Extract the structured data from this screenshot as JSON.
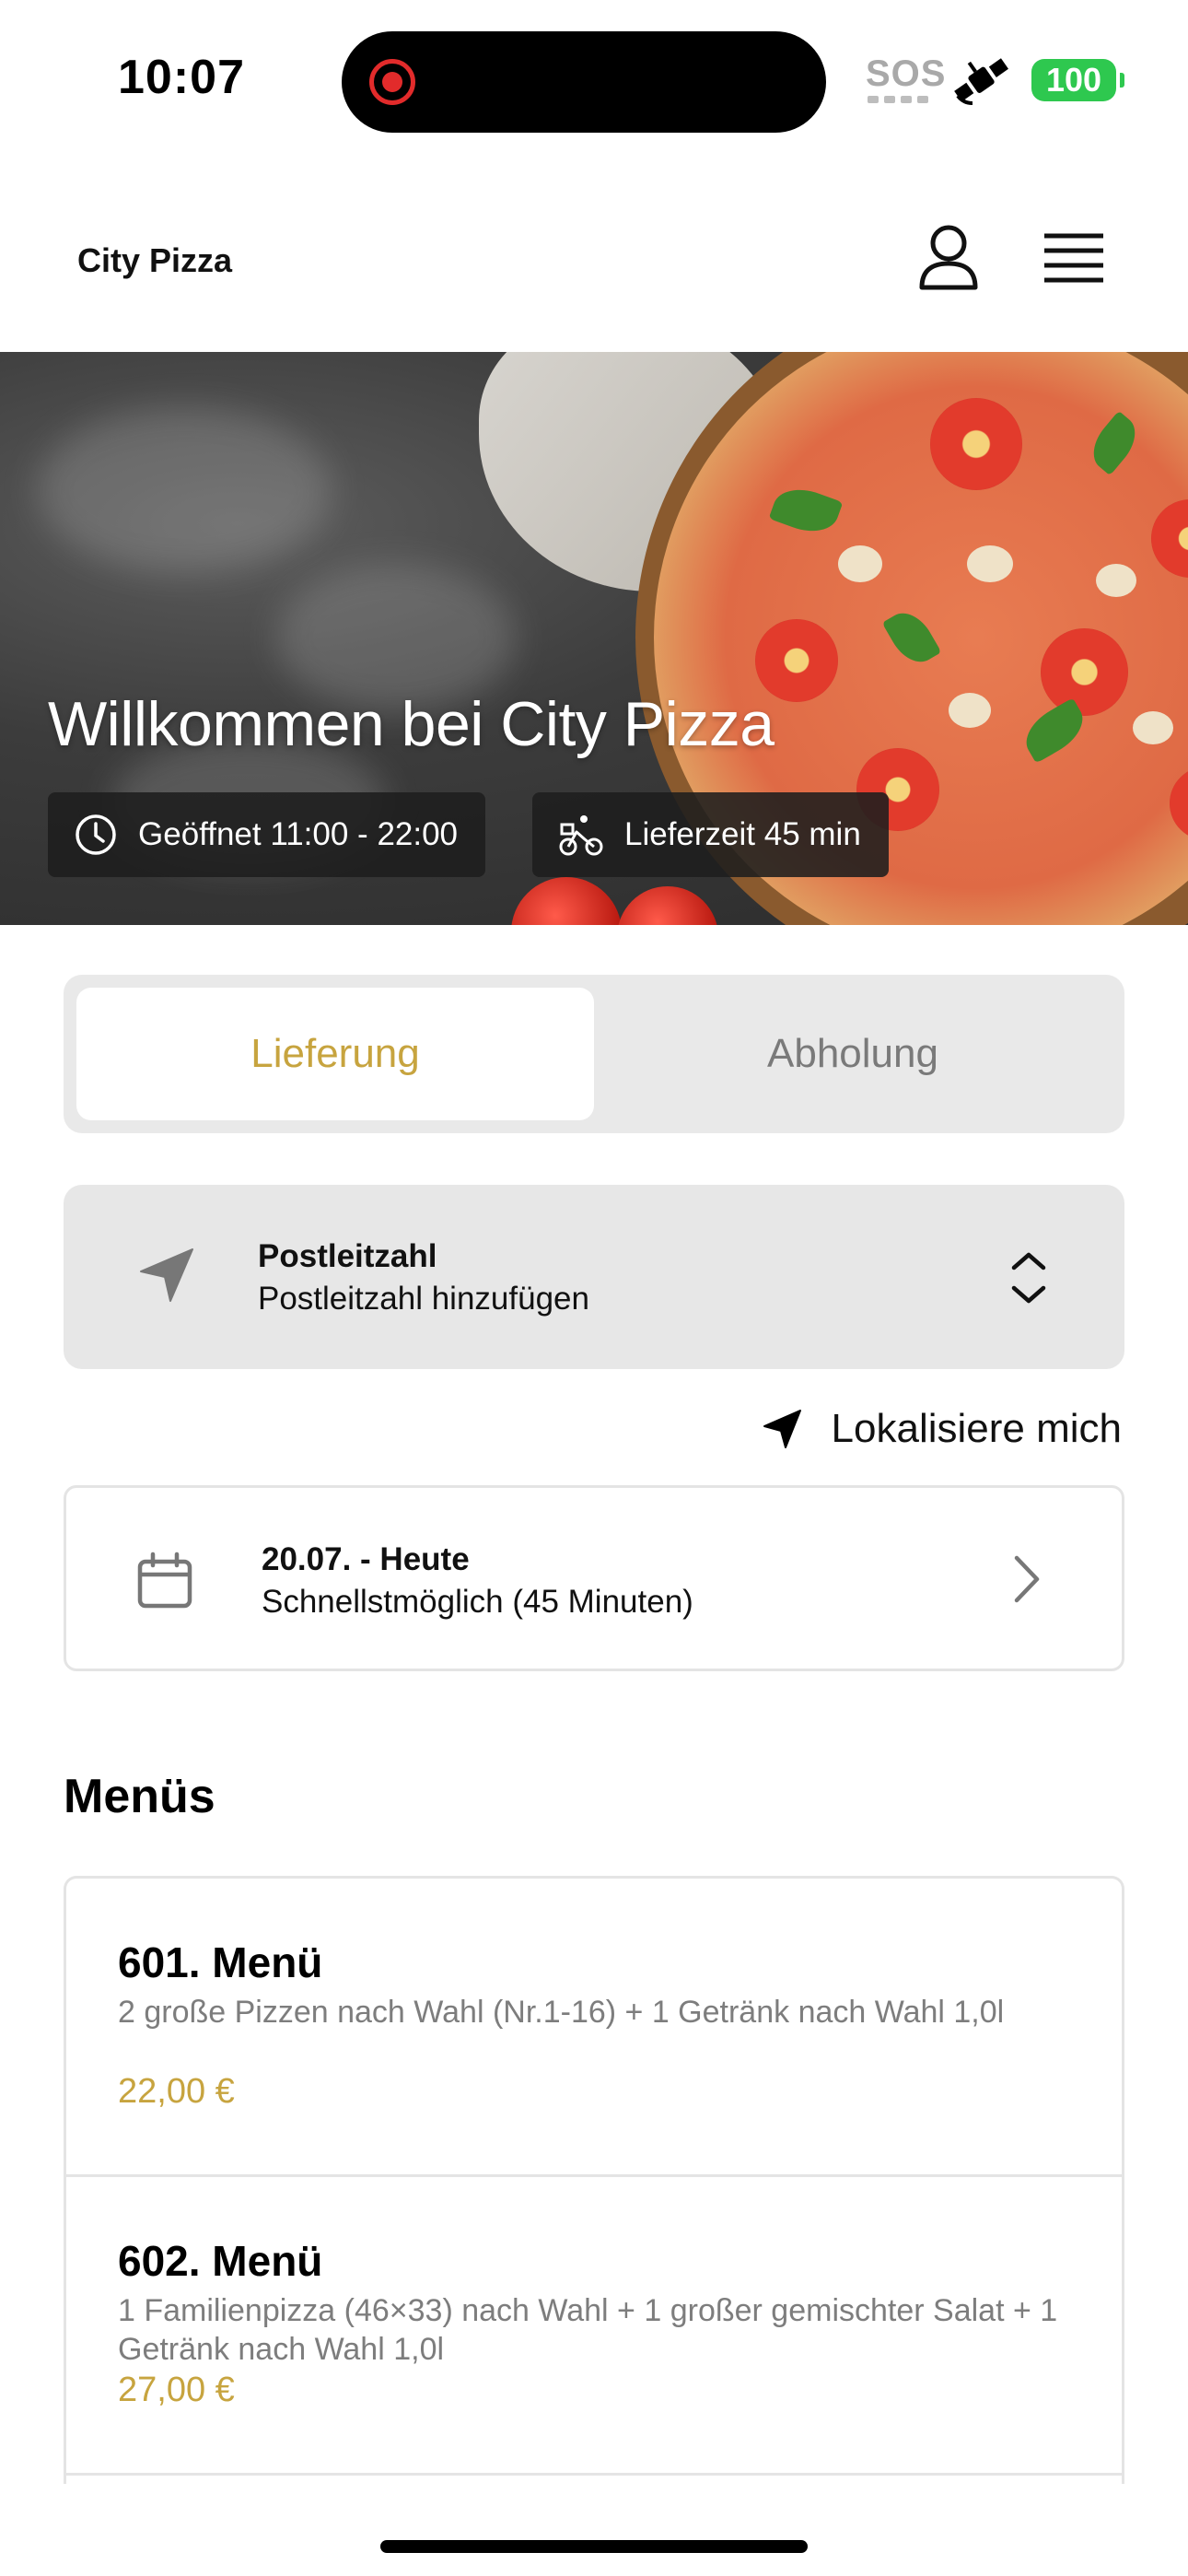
{
  "status_bar": {
    "time": "10:07",
    "sos": "SOS",
    "battery": "100",
    "icons": [
      "screen-recording-icon",
      "satellite-icon",
      "battery-icon"
    ]
  },
  "header": {
    "brand": "City Pizza",
    "icons": [
      "user-icon",
      "hamburger-menu-icon"
    ]
  },
  "hero": {
    "title": "Willkommen bei City Pizza",
    "opening_hours": "Geöffnet 11:00 - 22:00",
    "delivery_time": "Lieferzeit 45 min",
    "icons": [
      "clock-icon",
      "bicycle-courier-icon"
    ]
  },
  "order_mode": {
    "options": [
      "Lieferung",
      "Abholung"
    ],
    "selected": "Lieferung"
  },
  "postal_code": {
    "label": "Postleitzahl",
    "placeholder": "Postleitzahl hinzufügen",
    "icons": [
      "location-arrow-icon",
      "chevron-up-down-icon"
    ]
  },
  "locate": {
    "label": "Lokalisiere mich",
    "icon": "location-arrow-icon"
  },
  "schedule": {
    "date": "20.07. - Heute",
    "time": "Schnellstmöglich (45 Minuten)",
    "icons": [
      "calendar-icon",
      "chevron-right-icon"
    ]
  },
  "menus": {
    "title": "Menüs",
    "items": [
      {
        "name": "601. Menü",
        "description": "2 große Pizzen nach Wahl (Nr.1-16) + 1 Getränk nach Wahl 1,0l",
        "price": "22,00 €"
      },
      {
        "name": "602. Menü",
        "description": "1 Familienpizza (46×33) nach Wahl + 1 großer gemischter Salat + 1 Getränk nach Wahl 1,0l",
        "price": "27,00 €"
      }
    ]
  },
  "colors": {
    "accent": "#c7a43f",
    "battery": "#2ec84f",
    "recording": "#e22b2b",
    "panel": "#e9e9e9"
  }
}
